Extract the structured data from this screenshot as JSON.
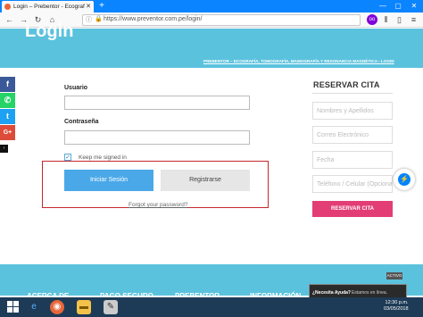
{
  "browser": {
    "tab_title": "Login – Prebentor - Ecografía, ...",
    "url": "https://www.preventor.com.pe/login/"
  },
  "page": {
    "hero_title": "Login",
    "breadcrumb": "PREBENTOR – ECOGRAFÍA, TOMOGRAFÍA, MAMOGRAFÍA Y RESONANCIA MAGNÉTICA › LOGIN"
  },
  "login": {
    "usuario_label": "Usuario",
    "usuario_value": "",
    "password_label": "Contraseña",
    "password_value": "",
    "remember_label": "Keep me signed in",
    "login_button": "Iniciar Sesión",
    "register_button": "Registrarse",
    "forgot_link": "Forgot your password?"
  },
  "reserve": {
    "title": "RESERVAR CITA",
    "name_placeholder": "Nombres y Apellidos",
    "email_placeholder": "Correo Electrónico",
    "date_placeholder": "Fecha",
    "phone_placeholder": "Teléfono / Celular (Opcional)",
    "submit": "RESERVAR CITA"
  },
  "footer": {
    "links": [
      "ACERCA DE",
      "PAGO SEGURO",
      "PREBENTOR",
      "INFORMACIÓN"
    ],
    "activo": "ACTIVO",
    "chat_title": "¿Necesita Ayuda?",
    "chat_sub": "Estamos en línea."
  },
  "taskbar": {
    "time": "12:30 p.m.",
    "date": "03/05/2018"
  },
  "colors": {
    "accent": "#5bc2dd",
    "login_button": "#4aa8e8",
    "reserve_button": "#e23d74",
    "highlight_box": "#c5262b"
  }
}
